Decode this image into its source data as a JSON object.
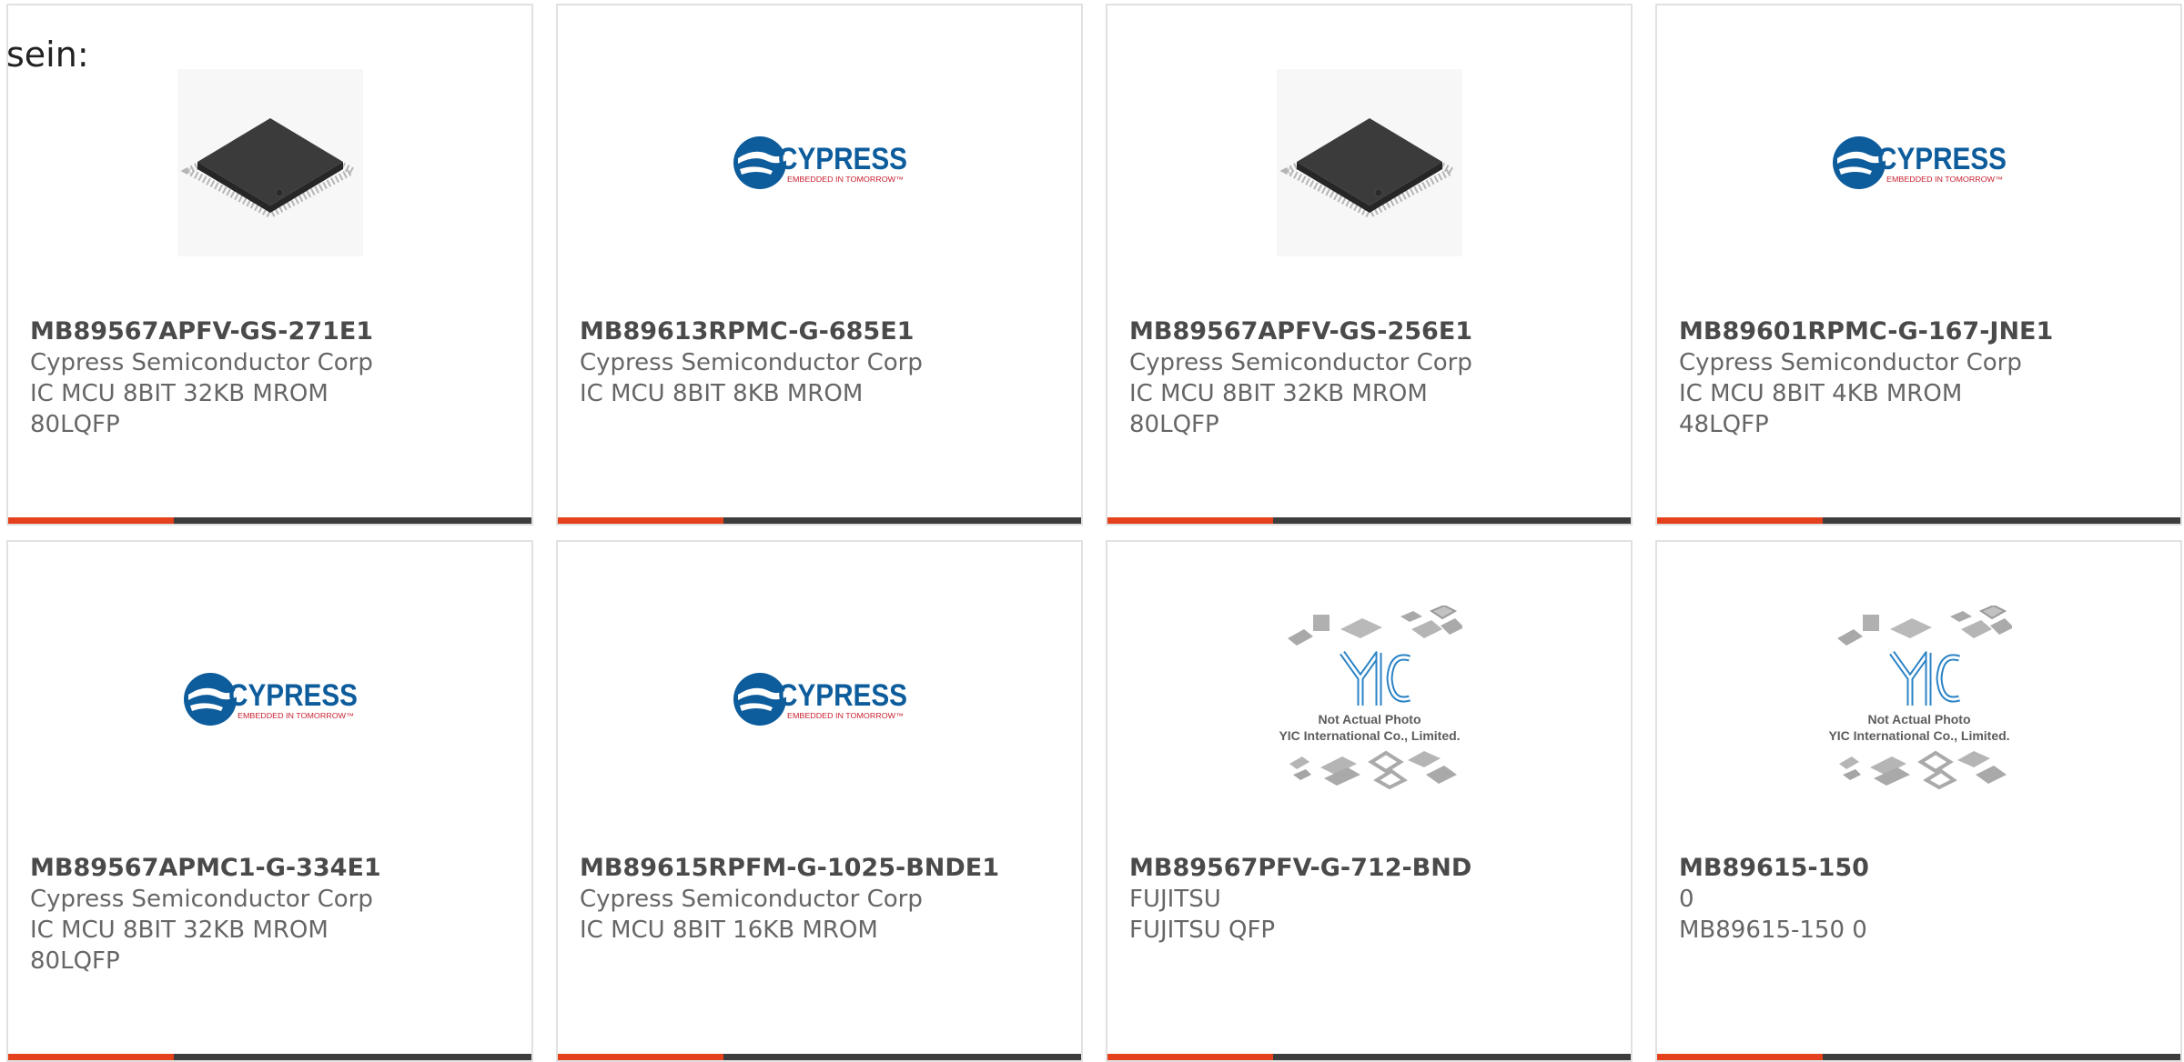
{
  "heading": "sein:",
  "colors": {
    "accent": "#e4411c",
    "bar": "#3d3d3d",
    "cypress_blue": "#0d5c9c"
  },
  "cypress_logo": {
    "name": "CYPRESS",
    "tagline": "EMBEDDED IN TOMORROW™"
  },
  "yic_logo": {
    "mark": "YIC",
    "line1": "Not Actual Photo",
    "line2": "YIC International Co., Limited."
  },
  "products": [
    {
      "part": "MB89567APFV-GS-271E1",
      "mfr": "Cypress Semiconductor Corp",
      "desc": "IC MCU 8BIT 32KB MROM 80LQFP",
      "image": "qfp-chip"
    },
    {
      "part": "MB89613RPMC-G-685E1",
      "mfr": "Cypress Semiconductor Corp",
      "desc": "IC MCU 8BIT 8KB MROM",
      "image": "cypress-logo"
    },
    {
      "part": "MB89567APFV-GS-256E1",
      "mfr": "Cypress Semiconductor Corp",
      "desc": "IC MCU 8BIT 32KB MROM 80LQFP",
      "image": "qfp-chip"
    },
    {
      "part": "MB89601RPMC-G-167-JNE1",
      "mfr": "Cypress Semiconductor Corp",
      "desc": "IC MCU 8BIT 4KB MROM 48LQFP",
      "image": "cypress-logo"
    },
    {
      "part": "MB89567APMC1-G-334E1",
      "mfr": "Cypress Semiconductor Corp",
      "desc": "IC MCU 8BIT 32KB MROM 80LQFP",
      "image": "cypress-logo"
    },
    {
      "part": "MB89615RPFM-G-1025-BNDE1",
      "mfr": "Cypress Semiconductor Corp",
      "desc": "IC MCU 8BIT 16KB MROM",
      "image": "cypress-logo"
    },
    {
      "part": "MB89567PFV-G-712-BND",
      "mfr": "FUJITSU",
      "desc": "FUJITSU QFP",
      "image": "yic-placeholder"
    },
    {
      "part": "MB89615-150",
      "mfr": "0",
      "desc": "MB89615-150 0",
      "image": "yic-placeholder"
    }
  ]
}
